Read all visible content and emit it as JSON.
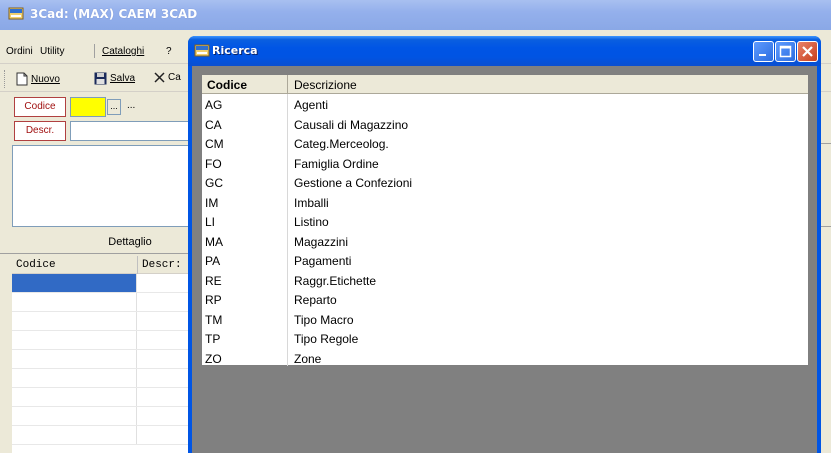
{
  "main": {
    "title": "3Cad: (MAX) CAEM 3CAD",
    "menu": [
      "Ordini",
      "Utility",
      "Cataloghi",
      "?"
    ],
    "toolbar": {
      "nuovo": "Nuovo",
      "salva": "Salva",
      "cancella_partial": "Ca"
    },
    "form": {
      "codice_label": "Codice",
      "descr_label": "Descr.",
      "browse_label": "...",
      "dots": "..."
    },
    "dettaglio_label": "Dettaglio",
    "grid": {
      "col1": "Codice",
      "col2": "Descr:"
    }
  },
  "dialog": {
    "title": "Ricerca",
    "columns": {
      "codice": "Codice",
      "descrizione": "Descrizione"
    },
    "rows": [
      {
        "code": "AG",
        "desc": "Agenti"
      },
      {
        "code": "CA",
        "desc": "Causali di Magazzino"
      },
      {
        "code": "CM",
        "desc": "Categ.Merceolog."
      },
      {
        "code": "FO",
        "desc": "Famiglia Ordine"
      },
      {
        "code": "GC",
        "desc": "Gestione a Confezioni"
      },
      {
        "code": "IM",
        "desc": "Imballi"
      },
      {
        "code": "LI",
        "desc": "Listino"
      },
      {
        "code": "MA",
        "desc": "Magazzini"
      },
      {
        "code": "PA",
        "desc": "Pagamenti"
      },
      {
        "code": "RE",
        "desc": "Raggr.Etichette"
      },
      {
        "code": "RP",
        "desc": "Reparto"
      },
      {
        "code": "TM",
        "desc": "Tipo Macro"
      },
      {
        "code": "TP",
        "desc": "Tipo Regole"
      },
      {
        "code": "ZO",
        "desc": "Zone"
      }
    ]
  },
  "colors": {
    "selection": "#316ac5",
    "required_field": "#ffff00",
    "xp_title_blue": "#0055e5"
  }
}
